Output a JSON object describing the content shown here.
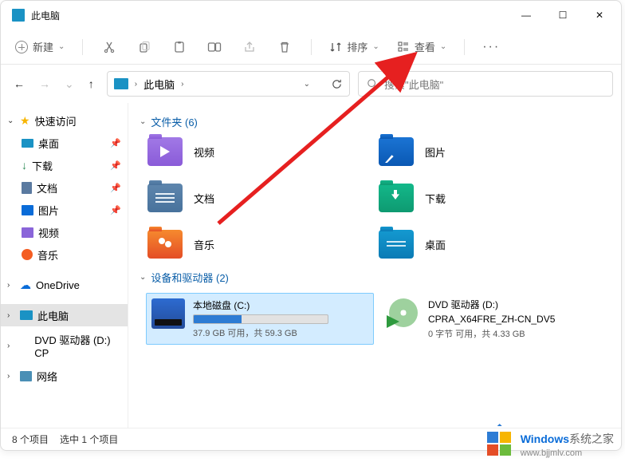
{
  "window": {
    "title": "此电脑"
  },
  "toolbar": {
    "new_label": "新建",
    "sort_label": "排序",
    "view_label": "查看"
  },
  "address": {
    "location": "此电脑",
    "separator": "›"
  },
  "search": {
    "placeholder": "搜索\"此电脑\""
  },
  "sidebar": {
    "quick_access": "快速访问",
    "desktop": "桌面",
    "downloads": "下载",
    "documents": "文档",
    "pictures": "图片",
    "videos": "视频",
    "music": "音乐",
    "onedrive": "OneDrive",
    "this_pc": "此电脑",
    "dvd": "DVD 驱动器 (D:) CP",
    "network": "网络"
  },
  "groups": {
    "folders_label": "文件夹 (6)",
    "drives_label": "设备和驱动器 (2)"
  },
  "folders": {
    "videos": "视频",
    "pictures": "图片",
    "documents": "文档",
    "downloads": "下载",
    "music": "音乐",
    "desktop": "桌面"
  },
  "drives": {
    "c": {
      "name": "本地磁盘 (C:)",
      "detail": "37.9 GB 可用，共 59.3 GB",
      "used_pct": 36
    },
    "d": {
      "name": "DVD 驱动器 (D:)",
      "label": "CPRA_X64FRE_ZH-CN_DV5",
      "detail": "0 字节 可用，共 4.33 GB"
    }
  },
  "status": {
    "count": "8 个项目",
    "selection": "选中 1 个项目"
  },
  "watermark": {
    "brand": "Windows",
    "suffix": "系统之家",
    "url": "www.bjjmlv.com"
  }
}
